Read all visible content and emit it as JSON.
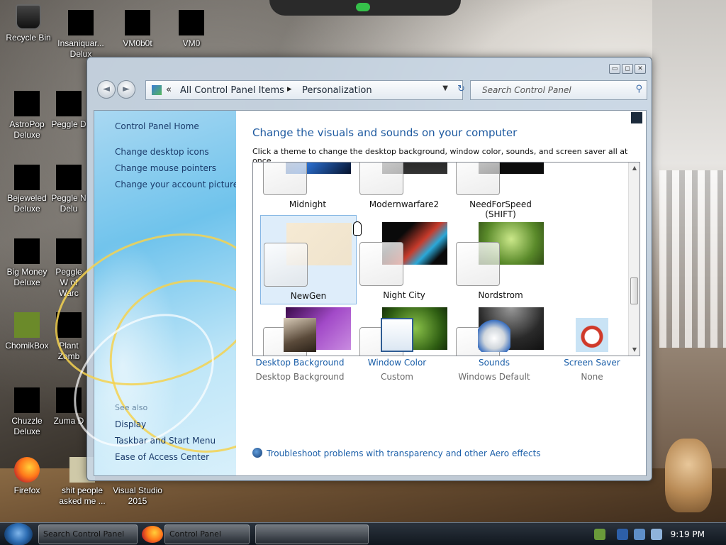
{
  "desktop": {
    "icons": [
      {
        "label": "Recycle Bin"
      },
      {
        "label": "Insaniquar... Delux"
      },
      {
        "label": "VM0b0t"
      },
      {
        "label": "VM0"
      },
      {
        "label": "AstroPop Deluxe"
      },
      {
        "label": "Peggle D"
      },
      {
        "label": "Bejeweled Deluxe"
      },
      {
        "label": "Peggle N Delu"
      },
      {
        "label": "Big Money Deluxe"
      },
      {
        "label": "Peggle W of Warc"
      },
      {
        "label": "ChomikBox"
      },
      {
        "label": "Plant Zomb"
      },
      {
        "label": "Chuzzle Deluxe"
      },
      {
        "label": "Zuma D"
      },
      {
        "label": "Firefox"
      },
      {
        "label": "shit people asked me ..."
      },
      {
        "label": "Visual Studio 2015"
      }
    ]
  },
  "window": {
    "controls": {
      "minimize": "▭",
      "maximize": "◻",
      "close": "✕"
    },
    "nav": {
      "back": "◄",
      "forward": "►"
    },
    "address": {
      "chevron": "«",
      "crumb1": "All Control Panel Items",
      "separator": "▸",
      "crumb2": "Personalization",
      "dropdown": "▼",
      "refresh": "↻"
    },
    "search": {
      "placeholder": "Search Control Panel",
      "icon": "⚲"
    }
  },
  "sidebar": {
    "home": "Control Panel Home",
    "links": [
      "Change desktop icons",
      "Change mouse pointers",
      "Change your account picture"
    ],
    "see_also_title": "See also",
    "see_also": [
      "Display",
      "Taskbar and Start Menu",
      "Ease of Access Center"
    ]
  },
  "main": {
    "title": "Change the visuals and sounds on your computer",
    "subtitle": "Click a theme to change the desktop background, window color, sounds, and screen saver all at once.",
    "themes": [
      {
        "label": "Midnight"
      },
      {
        "label": "Modernwarfare2"
      },
      {
        "label": "NeedForSpeed (SHIFT)"
      },
      {
        "label": "NewGen"
      },
      {
        "label": "Night City"
      },
      {
        "label": "Nordstrom"
      },
      {
        "label": ""
      },
      {
        "label": ""
      },
      {
        "label": ""
      }
    ],
    "selected_theme": "NewGen",
    "bottom": [
      {
        "link": "Desktop Background",
        "value": "Desktop Background"
      },
      {
        "link": "Window Color",
        "value": "Custom"
      },
      {
        "link": "Sounds",
        "value": "Windows Default"
      },
      {
        "link": "Screen Saver",
        "value": "None"
      }
    ],
    "troubleshoot": "Troubleshoot problems with transparency and other Aero effects"
  },
  "taskbar": {
    "items": [
      {
        "label": "Search Control Panel"
      },
      {
        "label": "Control Panel"
      },
      {
        "label": ""
      }
    ],
    "clock": "9:19 PM"
  }
}
